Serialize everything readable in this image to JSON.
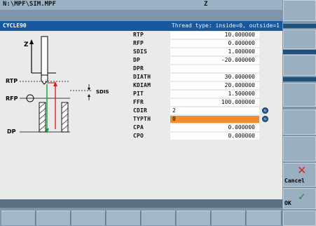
{
  "window": {
    "path": "N:\\MPF\\SIM.MPF",
    "channel": "Z"
  },
  "header": {
    "title": "CYCLE90",
    "hint": "Thread type: inside=0, outside=1"
  },
  "params": [
    {
      "label": "RTP",
      "value": "10.000000"
    },
    {
      "label": "RFP",
      "value": "0.000000"
    },
    {
      "label": "SDIS",
      "value": "1.000000"
    },
    {
      "label": "DP",
      "value": "-20.000000"
    },
    {
      "label": "DPR",
      "value": ""
    },
    {
      "label": "DIATH",
      "value": "30.000000"
    },
    {
      "label": "KDIAM",
      "value": "20.000000"
    },
    {
      "label": "PIT",
      "value": "1.500000"
    },
    {
      "label": "FFR",
      "value": "100.000000"
    },
    {
      "label": "CDIR",
      "value": "2"
    },
    {
      "label": "TYPTH",
      "value": "0"
    },
    {
      "label": "CPA",
      "value": "0.000000"
    },
    {
      "label": "CPO",
      "value": "0.000000"
    }
  ],
  "diagram": {
    "z_label": "Z",
    "rtp_label": "RTP",
    "rfp_label": "RFP",
    "sdis_label": "SDIS",
    "dp_label": "DP"
  },
  "softkeys": {
    "cancel_label": "Cancel",
    "ok_label": "OK"
  },
  "colors": {
    "header": "#18589e",
    "highlight": "#f08d2d",
    "cancel": "#e0231f",
    "ok": "#1c8a33"
  }
}
